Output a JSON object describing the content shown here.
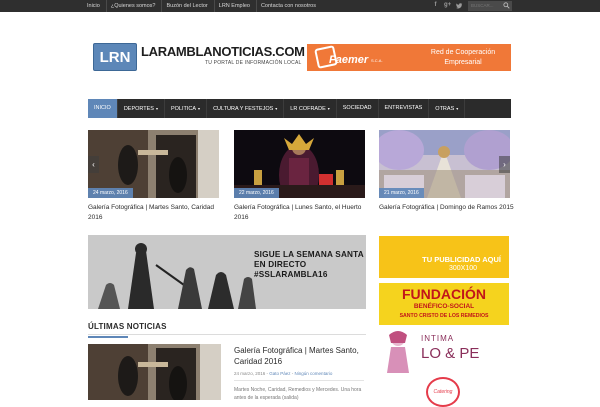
{
  "topbar": {
    "links": [
      "Inicio",
      "¿Quienes somos?",
      "Buzón del Lector",
      "LRN Empleo",
      "Contacta con nosotros"
    ],
    "search_placeholder": "BUSCAR..."
  },
  "logo": {
    "badge": "LRN",
    "name": "LARAMBLANOTICIAS.COM",
    "tagline": "TU PORTAL DE INFORMACIÓN LOCAL"
  },
  "top_banner": {
    "brand": "Faemer",
    "brand_sub": "S.C.A.",
    "line1": "Red de Cooperación",
    "line2": "Empresarial"
  },
  "nav": {
    "items": [
      {
        "label": "INICIO",
        "active": true,
        "caret": false
      },
      {
        "label": "DEPORTES",
        "active": false,
        "caret": true
      },
      {
        "label": "POLITICA",
        "active": false,
        "caret": true
      },
      {
        "label": "CULTURA Y FESTEJOS",
        "active": false,
        "caret": true
      },
      {
        "label": "LR COFRADE",
        "active": false,
        "caret": true
      },
      {
        "label": "SOCIEDAD",
        "active": false,
        "caret": false
      },
      {
        "label": "ENTREVISTAS",
        "active": false,
        "caret": false
      },
      {
        "label": "OTRAS",
        "active": false,
        "caret": true
      }
    ]
  },
  "slider": {
    "items": [
      {
        "date": "24 marzo, 2016",
        "title": "Galería Fotográfica | Martes Santo, Caridad 2016"
      },
      {
        "date": "22 marzo, 2016",
        "title": "Galería Fotográfica | Lunes Santo, el Huerto 2016"
      },
      {
        "date": "21 marzo, 2016",
        "title": "Galería Fotográfica | Domingo de Ramos 2015"
      }
    ],
    "prev_symbol": "‹",
    "next_symbol": "›"
  },
  "live_banner": {
    "line1": "SIGUE LA SEMANA SANTA",
    "line2": "EN DIRECTO",
    "line3": "#SSLARAMBLA16"
  },
  "latest": {
    "section_title": "ÚLTIMAS NOTICIAS",
    "title": "Galería Fotográfica | Martes Santo, Caridad 2016",
    "date": "24 marzo, 2016",
    "author": "Gato Páez",
    "comments": "Ningún comentario",
    "excerpt": "Martes Noche, Caridad, Remedios y Mercedes. Una hora antes de la esperada (salida)"
  },
  "ads": {
    "ad1_line1": "TU PUBLICIDAD AQUÍ",
    "ad1_line2": "300X100",
    "ad2_line1": "FUNDACIÓN",
    "ad2_line2": "BENÉFICO-SOCIAL",
    "ad2_line3": "SANTO CRISTO DE LOS REMEDIOS",
    "ad3_line1": "INTIMA",
    "ad3_line2": "LO & PE",
    "ad4_line1": "Catering"
  },
  "colors": {
    "accent": "#5f87b8",
    "topbar": "#2f2f2f",
    "nav": "#2b2b2b",
    "faemer_orange": "#f07838",
    "ad_yellow": "#f7c318",
    "fundacion_red": "#c2151a"
  },
  "icons": [
    "facebook-icon",
    "google-plus-icon",
    "twitter-icon",
    "search-icon"
  ]
}
